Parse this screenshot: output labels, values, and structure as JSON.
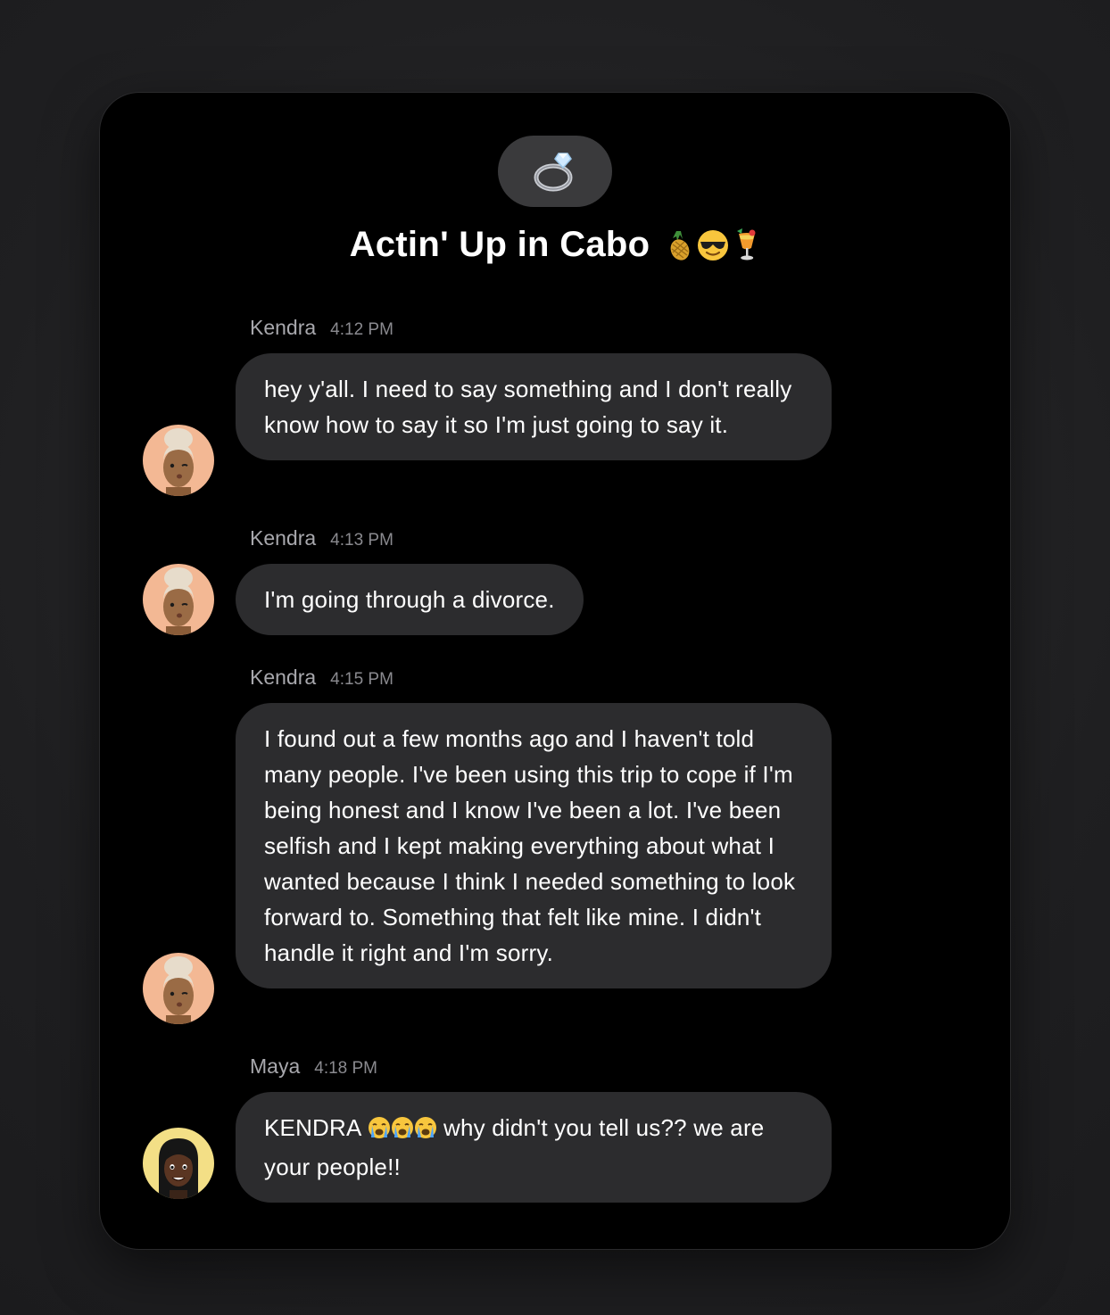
{
  "chat": {
    "group_icon": "ring-icon",
    "title": "Actin' Up in Cabo",
    "title_emojis": [
      "pineapple-icon",
      "sunglasses-face-icon",
      "tropical-drink-icon"
    ],
    "messages": [
      {
        "sender": "Kendra",
        "time": "4:12 PM",
        "text": "hey y'all. I need to say something and I don't really know how to say it so I'm just going to say it.",
        "avatar": "kendra-avatar"
      },
      {
        "sender": "Kendra",
        "time": "4:13 PM",
        "text": "I'm going through a divorce.",
        "avatar": "kendra-avatar"
      },
      {
        "sender": "Kendra",
        "time": "4:15 PM",
        "text": "I found out a few months ago and I haven't told many people. I've been using this trip to cope if I'm being honest and I know I've been a lot. I've been selfish and I kept making everything about what I wanted because I think I needed something to look forward to. Something that felt like mine. I didn't handle it right and I'm sorry.",
        "avatar": "kendra-avatar"
      },
      {
        "sender": "Maya",
        "time": "4:18 PM",
        "text_prefix": "KENDRA",
        "text_emojis": [
          "crying-face-icon",
          "crying-face-icon",
          "crying-face-icon"
        ],
        "text_suffix": "why didn't you tell us?? we are your people!!",
        "avatar": "maya-avatar"
      }
    ]
  },
  "colors": {
    "background": "#1f1f21",
    "window": "#000000",
    "bubble": "#2c2c2e",
    "group_icon_bg": "#3a3a3c",
    "sender_text": "#a8a8ad",
    "time_text": "#8a8a8f"
  }
}
